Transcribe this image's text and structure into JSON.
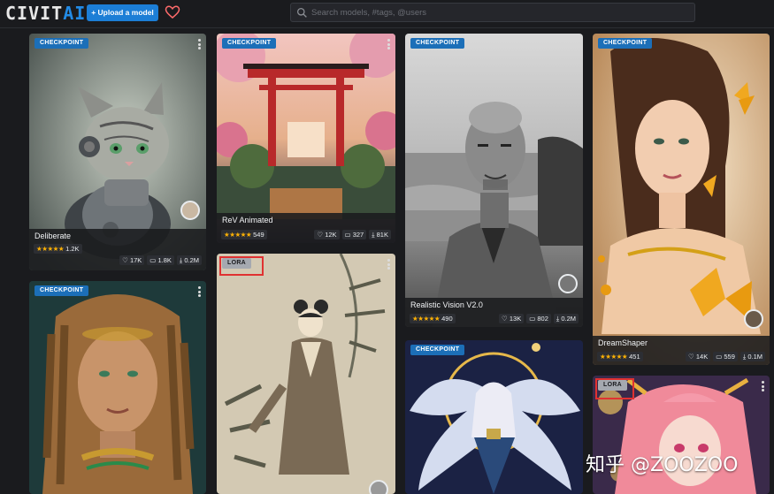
{
  "header": {
    "logo_main": "CIVIT",
    "logo_accent": "AI",
    "upload_label": "+ Upload a model",
    "search_placeholder": "Search models, #tags, @users"
  },
  "cards": [
    {
      "badge": "CHECKPOINT",
      "title": "Deliberate",
      "rating": "1.2K",
      "likes": "17K",
      "comments": "1.8K",
      "downloads": "0.2M"
    },
    {
      "badge": "CHECKPOINT",
      "title": "ReV Animated",
      "rating": "549",
      "likes": "12K",
      "comments": "327",
      "downloads": "81K"
    },
    {
      "badge": "CHECKPOINT",
      "title": "Realistic Vision V2.0",
      "rating": "490",
      "likes": "13K",
      "comments": "802",
      "downloads": "0.2M"
    },
    {
      "badge": "CHECKPOINT",
      "title": "DreamShaper",
      "rating": "451",
      "likes": "14K",
      "comments": "559",
      "downloads": "0.1M"
    },
    {
      "badge": "CHECKPOINT"
    },
    {
      "badge": "LORA"
    },
    {
      "badge": "CHECKPOINT"
    },
    {
      "badge": "LORA"
    }
  ],
  "stars": "★★★★★",
  "watermark": "知乎 @ZOOZOO",
  "colors": {
    "background": "#1a1b1e",
    "card": "#25262b",
    "primary": "#1c7ed6",
    "star": "#fab005",
    "highlight": "#e03131",
    "heart": "#ff6b6b"
  }
}
